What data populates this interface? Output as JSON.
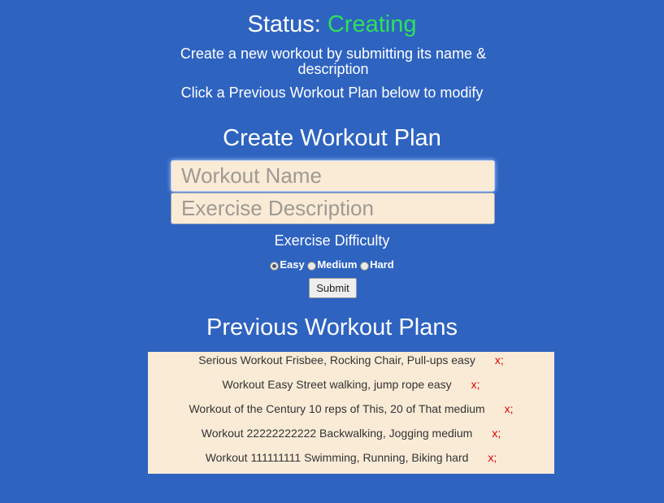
{
  "status": {
    "label": "Status:",
    "value": "Creating"
  },
  "hints": {
    "create": "Create a new workout by submitting its name & description",
    "modify": "Click a Previous Workout Plan below to modify"
  },
  "form": {
    "title": "Create Workout Plan",
    "name_placeholder": "Workout Name",
    "description_placeholder": "Exercise Description",
    "difficulty_label": "Exercise Difficulty",
    "difficulties": [
      {
        "label": "Easy",
        "selected": true
      },
      {
        "label": "Medium",
        "selected": false
      },
      {
        "label": "Hard",
        "selected": false
      }
    ],
    "submit_label": "Submit"
  },
  "previous": {
    "title": "Previous Workout Plans",
    "delete_label": "x;",
    "items": [
      {
        "text": "Serious Workout Frisbee, Rocking Chair, Pull-ups easy"
      },
      {
        "text": "Workout Easy Street walking, jump rope easy"
      },
      {
        "text": "Workout of the Century 10 reps of This, 20 of That medium"
      },
      {
        "text": "Workout 22222222222 Backwalking, Jogging medium"
      },
      {
        "text": "Workout 111111111 Swimming, Running, Biking hard"
      }
    ]
  },
  "colors": {
    "background": "#2e63c0",
    "status_active": "#2ee05c",
    "panel": "#faebd7",
    "delete": "#e00000"
  }
}
